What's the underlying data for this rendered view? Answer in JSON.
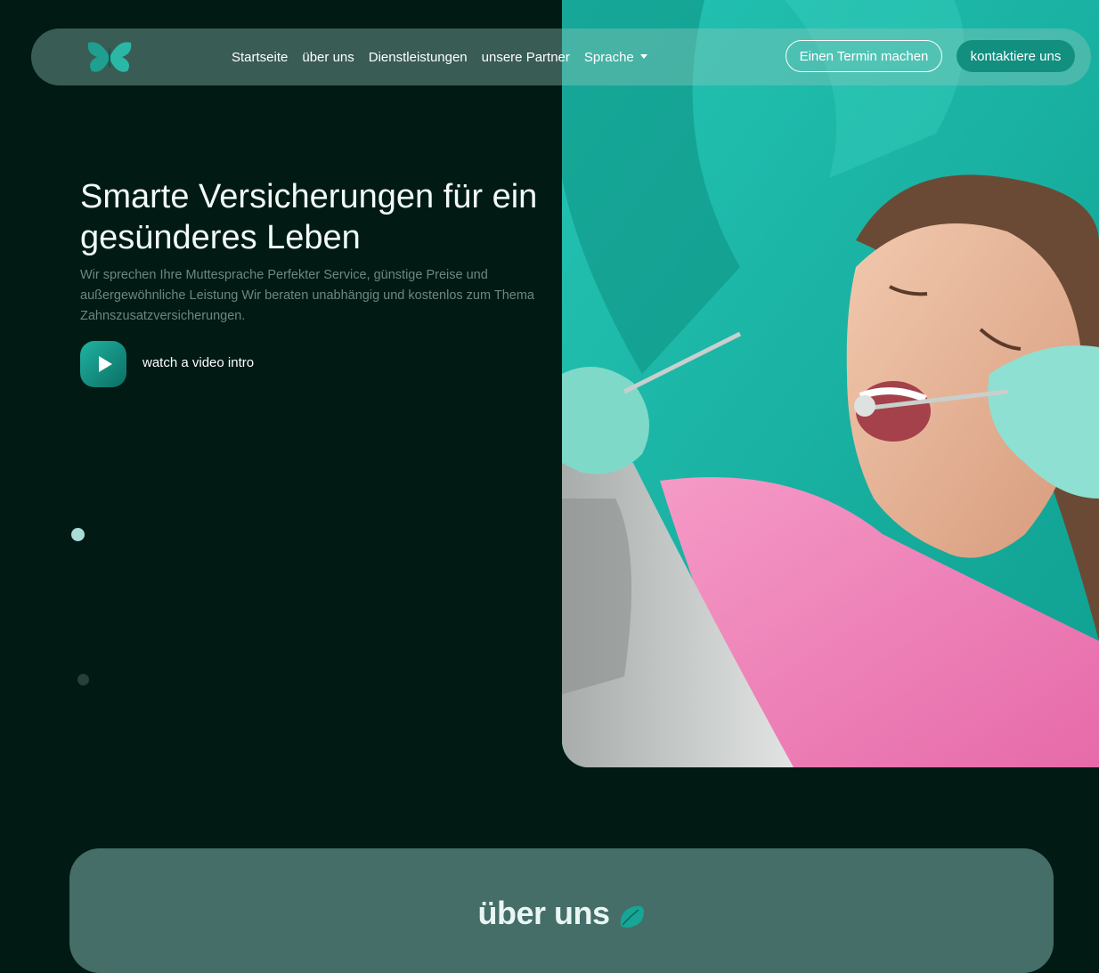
{
  "nav": {
    "logo_icon": "butterfly-logo-icon",
    "links": [
      "Startseite",
      "über uns",
      "Dienstleistungen",
      "unsere Partner"
    ],
    "language_label": "Sprache",
    "appointment_button": "Einen Termin machen",
    "contact_button": "kontaktiere uns"
  },
  "hero": {
    "title": "Smarte Versicherungen für ein gesünderes Leben",
    "description": "Wir sprechen Ihre Muttesprache Perfekter Service, günstige Preise und außergewöhnliche Leistung Wir beraten unabhängig und kostenlos zum Thema Zahnszusatzversicherungen.",
    "video_label": "watch a video intro",
    "video_icon": "play-icon",
    "image": "dental-checkup-photo"
  },
  "slider": {
    "dot_count": 2,
    "active_index": 0
  },
  "about": {
    "heading": "über uns",
    "heading_icon": "leaf-icon"
  },
  "colors": {
    "background": "#011a14",
    "accent": "#138f80",
    "card": "#446e67",
    "muted_text": "#6f8682"
  }
}
